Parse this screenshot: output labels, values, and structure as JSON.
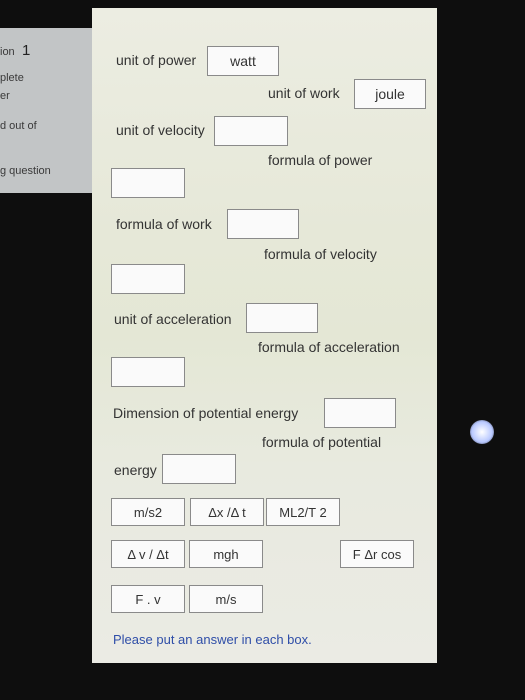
{
  "sidebar": {
    "question_partial": "ion",
    "question_number": "1",
    "status_partial_1": "plete",
    "status_partial_2": "er",
    "marked_partial": "d out of",
    "flag_partial": "g question"
  },
  "labels": {
    "unit_of_power": "unit of power",
    "unit_of_work": "unit of  work",
    "unit_of_velocity": "unit of velocity",
    "formula_of_power": "formula of power",
    "formula_of_work": "formula of work",
    "formula_of_velocity": "formula of velocity",
    "unit_of_acceleration": "unit of acceleration",
    "formula_of_acceleration": "formula of acceleration",
    "dimension_of_potential_energy": "Dimension of potential energy",
    "formula_of_potential": "formula of potential",
    "energy": "energy"
  },
  "answers": {
    "unit_of_power": "watt",
    "unit_of_work": "joule"
  },
  "choices": [
    "m/s2",
    "Δx /Δ t",
    "ML2/T 2",
    "Δ v /  Δt",
    "mgh",
    "F Δr cos",
    "F . v",
    "m/s"
  ],
  "message": "Please put an answer in each box."
}
